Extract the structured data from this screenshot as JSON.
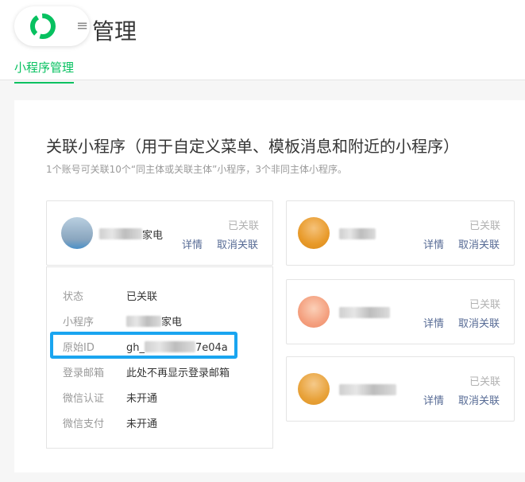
{
  "header": {
    "title": "管理",
    "menu_glyph": "≡"
  },
  "tabs": [
    {
      "label": "小程序管理"
    }
  ],
  "section": {
    "title": "关联小程序（用于自定义菜单、模板消息和附近的小程序）",
    "desc": "1个账号可关联10个“同主体或关联主体”小程序，3个非同主体小程序。"
  },
  "cards": [
    {
      "name_suffix": "家电",
      "status": "已关联",
      "detail": "详情",
      "unlink": "取消关联",
      "avatar_color": "#9fb6c9"
    },
    {
      "name_suffix": "",
      "status": "已关联",
      "detail": "详情",
      "unlink": "取消关联",
      "avatar_color": "#e89a2a"
    },
    {
      "name_suffix": "",
      "status": "已关联",
      "detail": "详情",
      "unlink": "取消关联",
      "avatar_color": "#f4a07f"
    },
    {
      "name_suffix": "",
      "status": "已关联",
      "detail": "详情",
      "unlink": "取消关联",
      "avatar_color": "#e8a23a"
    }
  ],
  "details": {
    "status_label": "状态",
    "status_value": "已关联",
    "app_label": "小程序",
    "app_value_suffix": "家电",
    "id_label": "原始ID",
    "id_prefix": "gh_",
    "id_suffix": "7e04a",
    "email_label": "登录邮箱",
    "email_value": "此处不再显示登录邮箱",
    "wx_auth_label": "微信认证",
    "wx_auth_value": "未开通",
    "wx_pay_label": "微信支付",
    "wx_pay_value": "未开通"
  },
  "colors": {
    "accent": "#07c160",
    "link": "#576b95",
    "highlight": "#1aa5f0"
  }
}
